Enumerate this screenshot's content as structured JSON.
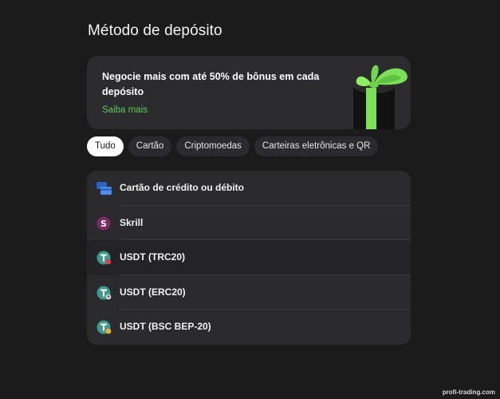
{
  "page": {
    "title": "Método de depósito"
  },
  "banner": {
    "text": "Negocie mais com até 50% de bônus em cada depósito",
    "link": "Saiba mais"
  },
  "tabs": [
    {
      "label": "Tudo",
      "active": true
    },
    {
      "label": "Cartão",
      "active": false
    },
    {
      "label": "Criptomoedas",
      "active": false
    },
    {
      "label": "Carteiras eletrônicas e QR",
      "active": false
    }
  ],
  "methods": [
    {
      "label": "Cartão de crédito ou débito",
      "icon": "card-icon"
    },
    {
      "label": "Skrill",
      "icon": "skrill-icon"
    },
    {
      "label": "USDT (TRC20)",
      "icon": "tether-trc20-icon"
    },
    {
      "label": "USDT (ERC20)",
      "icon": "tether-erc20-icon"
    },
    {
      "label": "USDT (BSC BEP-20)",
      "icon": "tether-bep20-icon"
    }
  ],
  "watermark": "profi-trading.com",
  "colors": {
    "background": "#1b1b1b",
    "card": "#2b2b2d",
    "accent_green": "#5ac85a",
    "tether": "#3d9a8c",
    "skrill": "#7a2b63",
    "card_blue": "#3a7be0"
  }
}
